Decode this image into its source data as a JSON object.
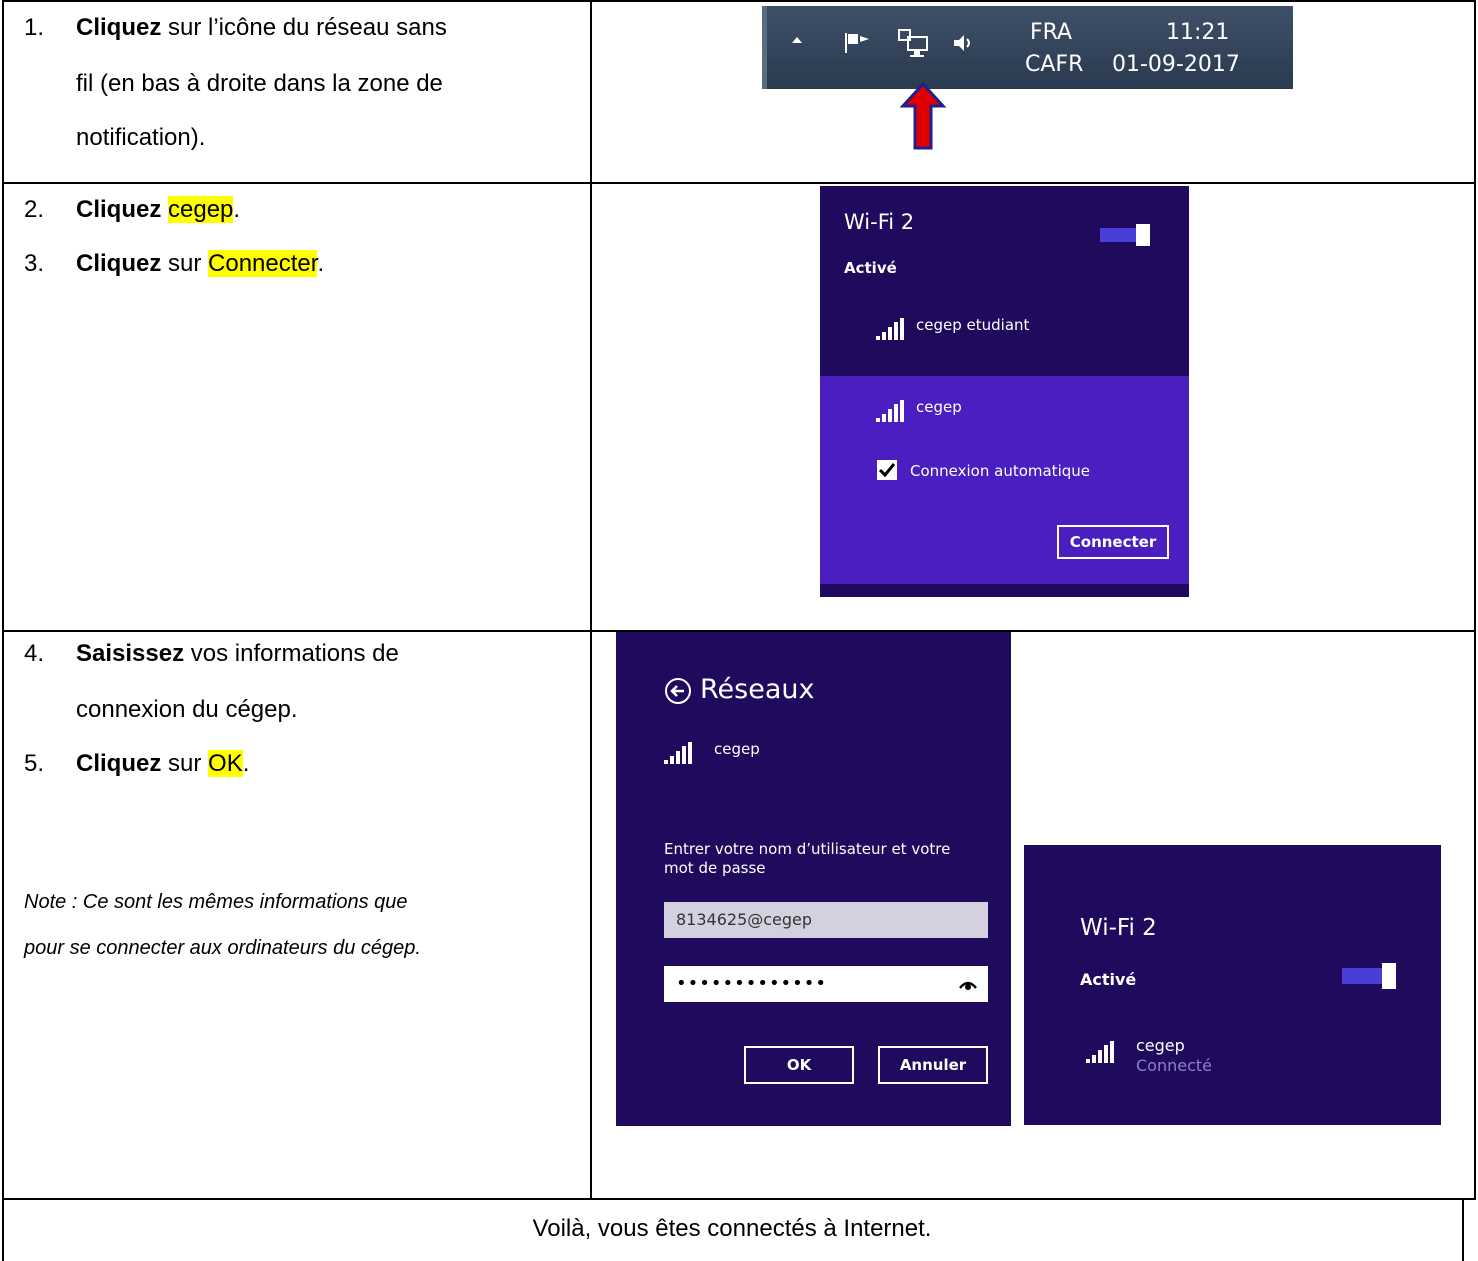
{
  "steps": [
    {
      "num": "1.",
      "bold": "Cliquez",
      "text": " sur l’icône du réseau sans",
      "line2": "fil (en bas à droite dans la zone de",
      "line3": "notification)."
    },
    {
      "num": "2.",
      "bold": "Cliquez",
      "text_pre": " ",
      "hl": "cegep",
      "text_post": "."
    },
    {
      "num": "3.",
      "bold": "Cliquez",
      "text_pre": " sur ",
      "hl": "Connecter",
      "text_post": "."
    },
    {
      "num": "4.",
      "bold": "Saisissez",
      "text": " vos informations de",
      "line2": "connexion du cégep."
    },
    {
      "num": "5.",
      "bold": "Cliquez",
      "text_pre": " sur ",
      "hl": "OK",
      "text_post": "."
    }
  ],
  "note": {
    "line1": "Note : Ce sont les mêmes informations que",
    "line2": "pour se connecter aux ordinateurs du cégep."
  },
  "footer": "Voilà, vous êtes connectés à Internet.",
  "taskbar": {
    "lang_top": "FRA",
    "lang_bottom": "CAFR",
    "time": "11:21",
    "date": "01-09-2017",
    "icons": [
      "arrow-up-icon",
      "flag-icon",
      "network-icon",
      "speaker-icon"
    ],
    "arrow_color": "#e00000"
  },
  "wifi_panel": {
    "title": "Wi-Fi 2",
    "status": "Activé",
    "networks": [
      "cegep etudiant",
      "cegep"
    ],
    "auto_connect_label": "Connexion automatique",
    "auto_connect_checked": true,
    "connect_button": "Connecter",
    "colors": {
      "dark": "#1f0a5e",
      "selected": "#4a1ec0"
    }
  },
  "login_panel": {
    "title": "Réseaux",
    "network": "cegep",
    "prompt_line1": "Entrer votre nom d’utilisateur et votre",
    "prompt_line2": "mot de passe",
    "username": "8134625@cegep",
    "password": "•••••••••••••",
    "ok_button": "OK",
    "cancel_button": "Annuler"
  },
  "connected_panel": {
    "title": "Wi-Fi 2",
    "status": "Activé",
    "network": "cegep",
    "network_status": "Connecté"
  }
}
